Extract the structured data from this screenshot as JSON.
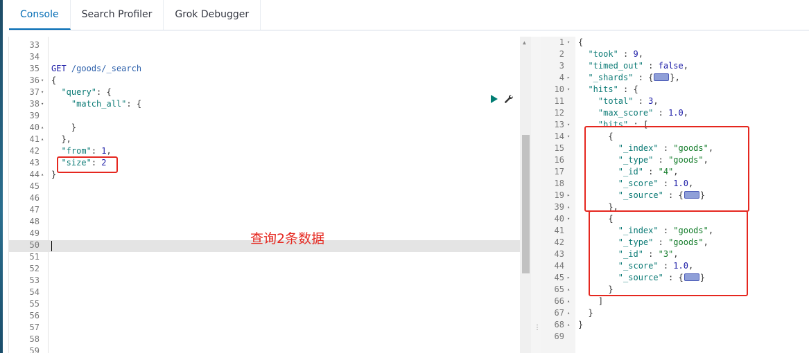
{
  "tabs": [
    "Console",
    "Search Profiler",
    "Grok Debugger"
  ],
  "request_lines": [
    {
      "n": "33",
      "fold": "",
      "text": ""
    },
    {
      "n": "34",
      "fold": "",
      "text": ""
    },
    {
      "n": "35",
      "fold": "",
      "text": "GET /goods/_search"
    },
    {
      "n": "36",
      "fold": "▾",
      "text": "{"
    },
    {
      "n": "37",
      "fold": "▾",
      "text": "  \"query\": {"
    },
    {
      "n": "38",
      "fold": "▾",
      "text": "    \"match_all\": {"
    },
    {
      "n": "39",
      "fold": "",
      "text": ""
    },
    {
      "n": "40",
      "fold": "▴",
      "text": "    }"
    },
    {
      "n": "41",
      "fold": "▴",
      "text": "  },"
    },
    {
      "n": "42",
      "fold": "",
      "text": "  \"from\": 1,"
    },
    {
      "n": "43",
      "fold": "",
      "text": "  \"size\": 2"
    },
    {
      "n": "44",
      "fold": "▴",
      "text": "}"
    },
    {
      "n": "45",
      "fold": "",
      "text": ""
    },
    {
      "n": "46",
      "fold": "",
      "text": ""
    },
    {
      "n": "47",
      "fold": "",
      "text": ""
    },
    {
      "n": "48",
      "fold": "",
      "text": ""
    },
    {
      "n": "49",
      "fold": "",
      "text": ""
    },
    {
      "n": "50",
      "fold": "",
      "text": ""
    },
    {
      "n": "51",
      "fold": "",
      "text": ""
    },
    {
      "n": "52",
      "fold": "",
      "text": ""
    },
    {
      "n": "53",
      "fold": "",
      "text": ""
    },
    {
      "n": "54",
      "fold": "",
      "text": ""
    },
    {
      "n": "55",
      "fold": "",
      "text": ""
    },
    {
      "n": "56",
      "fold": "",
      "text": ""
    },
    {
      "n": "57",
      "fold": "",
      "text": ""
    },
    {
      "n": "58",
      "fold": "",
      "text": ""
    },
    {
      "n": "59",
      "fold": "",
      "text": ""
    }
  ],
  "response_lines": [
    {
      "n": "1",
      "fold": "▾",
      "text": "{"
    },
    {
      "n": "2",
      "fold": "",
      "text": "  \"took\" : 9,"
    },
    {
      "n": "3",
      "fold": "",
      "text": "  \"timed_out\" : false,"
    },
    {
      "n": "4",
      "fold": "▸",
      "text": "  \"_shards\" : {",
      "badge": true,
      "after": "},"
    },
    {
      "n": "10",
      "fold": "▾",
      "text": "  \"hits\" : {"
    },
    {
      "n": "11",
      "fold": "",
      "text": "    \"total\" : 3,"
    },
    {
      "n": "12",
      "fold": "",
      "text": "    \"max_score\" : 1.0,"
    },
    {
      "n": "13",
      "fold": "▾",
      "text": "    \"hits\" : ["
    },
    {
      "n": "14",
      "fold": "▾",
      "text": "      {"
    },
    {
      "n": "15",
      "fold": "",
      "text": "        \"_index\" : \"goods\","
    },
    {
      "n": "16",
      "fold": "",
      "text": "        \"_type\" : \"goods\","
    },
    {
      "n": "17",
      "fold": "",
      "text": "        \"_id\" : \"4\","
    },
    {
      "n": "18",
      "fold": "",
      "text": "        \"_score\" : 1.0,"
    },
    {
      "n": "19",
      "fold": "▸",
      "text": "        \"_source\" : {",
      "badge": true,
      "after": "}"
    },
    {
      "n": "39",
      "fold": "▴",
      "text": "      },"
    },
    {
      "n": "40",
      "fold": "▾",
      "text": "      {"
    },
    {
      "n": "41",
      "fold": "",
      "text": "        \"_index\" : \"goods\","
    },
    {
      "n": "42",
      "fold": "",
      "text": "        \"_type\" : \"goods\","
    },
    {
      "n": "43",
      "fold": "",
      "text": "        \"_id\" : \"3\","
    },
    {
      "n": "44",
      "fold": "",
      "text": "        \"_score\" : 1.0,"
    },
    {
      "n": "45",
      "fold": "▸",
      "text": "        \"_source\" : {",
      "badge": true,
      "after": "}"
    },
    {
      "n": "65",
      "fold": "▴",
      "text": "      }"
    },
    {
      "n": "66",
      "fold": "▴",
      "text": "    ]"
    },
    {
      "n": "67",
      "fold": "▴",
      "text": "  }"
    },
    {
      "n": "68",
      "fold": "▴",
      "text": "}"
    },
    {
      "n": "69",
      "fold": "",
      "text": ""
    }
  ],
  "annotation": "查询2条数据",
  "colors": {
    "accent": "#006bb4",
    "run": "#017d73",
    "highlight_box": "#e5271f"
  },
  "icons": [
    "play-icon",
    "wrench-icon",
    "scroll-up-arrow-icon",
    "splitter-dots-icon"
  ]
}
